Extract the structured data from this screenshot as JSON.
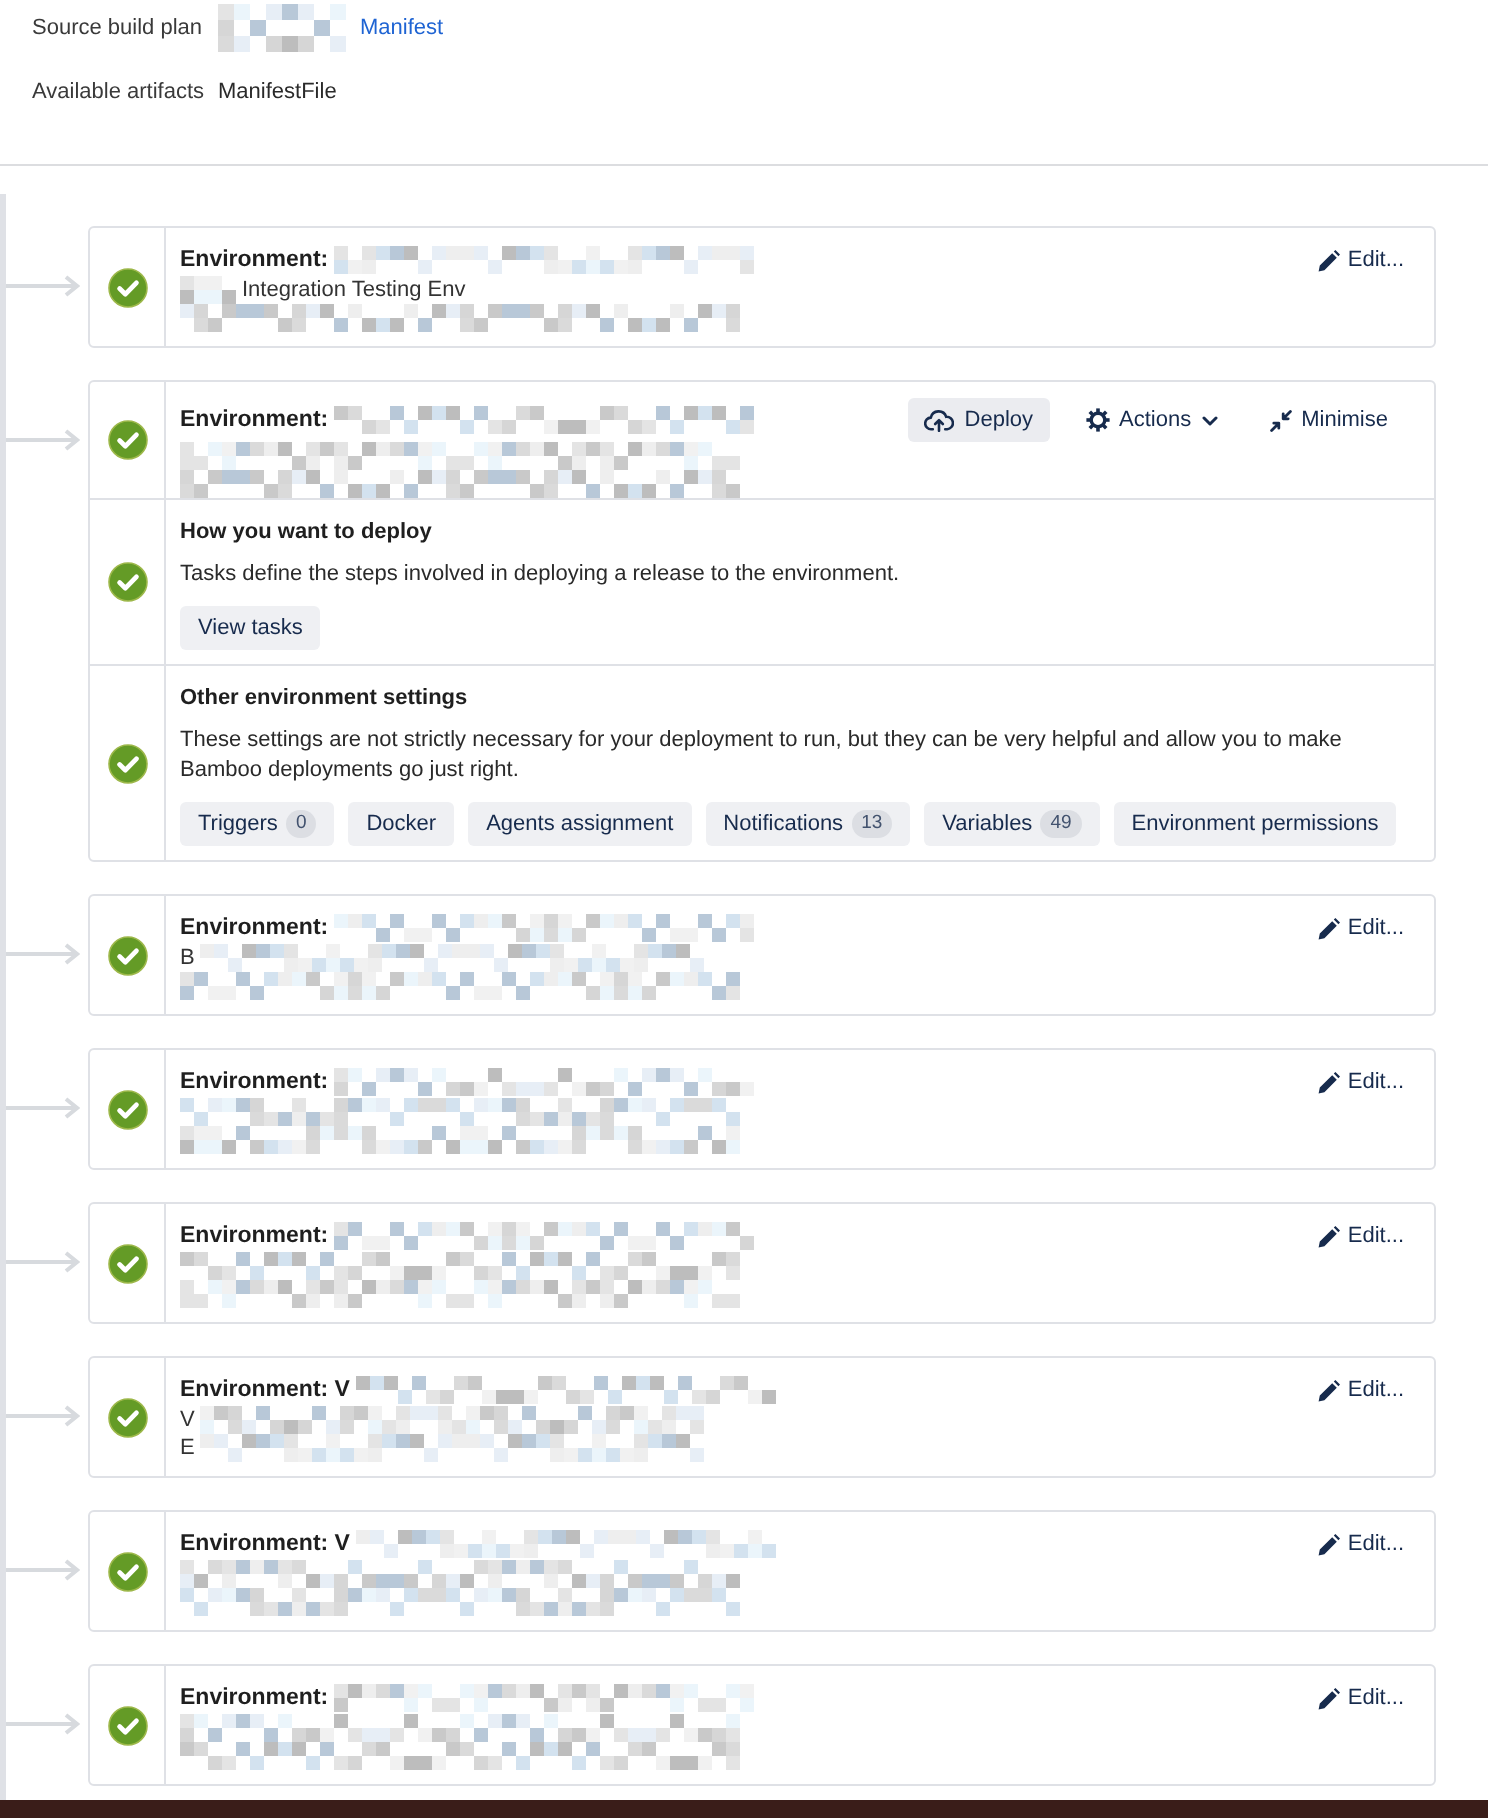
{
  "source": {
    "build_plan": {
      "label": "Source build plan",
      "link": "Manifest"
    },
    "artifacts": {
      "label": "Available artifacts",
      "value": "ManifestFile"
    }
  },
  "environments": [
    {
      "title": "Environment:",
      "passed": true,
      "lines": [
        {
          "kind": "suffix",
          "text": "Integration Testing Env"
        },
        {
          "kind": "masked"
        }
      ],
      "actions": [
        {
          "kind": "edit",
          "label": "Edit..."
        }
      ]
    },
    {
      "title": "Environment:",
      "passed": true,
      "lines": [
        {
          "kind": "masked"
        },
        {
          "kind": "masked"
        }
      ],
      "actions": [
        {
          "kind": "deploy",
          "label": "Deploy"
        },
        {
          "kind": "menu",
          "label": "Actions"
        },
        {
          "kind": "minimise",
          "label": "Minimise"
        }
      ],
      "sections": [
        {
          "heading": "How you want to deploy",
          "passed": true,
          "description": "Tasks define the steps involved in deploying a release to the environment.",
          "buttons": [
            {
              "label": "View tasks"
            }
          ]
        },
        {
          "heading": "Other environment settings",
          "passed": true,
          "description": "These settings are not strictly necessary for your deployment to run, but they can be very helpful and allow you to make Bamboo deployments go just right.",
          "buttons": [
            {
              "label": "Triggers",
              "count": "0"
            },
            {
              "label": "Docker"
            },
            {
              "label": "Agents assignment"
            },
            {
              "label": "Notifications",
              "count": "13"
            },
            {
              "label": "Variables",
              "count": "49"
            },
            {
              "label": "Environment permissions"
            }
          ]
        }
      ]
    },
    {
      "title": "Environment:",
      "passed": true,
      "lines": [
        {
          "kind": "prefix",
          "text": "B"
        },
        {
          "kind": "masked"
        }
      ],
      "actions": [
        {
          "kind": "edit",
          "label": "Edit..."
        }
      ]
    },
    {
      "title": "Environment:",
      "passed": true,
      "lines": [
        {
          "kind": "masked"
        },
        {
          "kind": "masked"
        }
      ],
      "actions": [
        {
          "kind": "edit",
          "label": "Edit..."
        }
      ]
    },
    {
      "title": "Environment:",
      "passed": true,
      "lines": [
        {
          "kind": "masked"
        },
        {
          "kind": "masked"
        }
      ],
      "actions": [
        {
          "kind": "edit",
          "label": "Edit..."
        }
      ]
    },
    {
      "title": "Environment: V",
      "passed": true,
      "lines": [
        {
          "kind": "prefix",
          "text": "V"
        },
        {
          "kind": "prefix",
          "text": "E"
        }
      ],
      "actions": [
        {
          "kind": "edit",
          "label": "Edit..."
        }
      ]
    },
    {
      "title": "Environment: V",
      "passed": true,
      "lines": [
        {
          "kind": "masked"
        },
        {
          "kind": "masked"
        }
      ],
      "actions": [
        {
          "kind": "edit",
          "label": "Edit..."
        }
      ]
    },
    {
      "title": "Environment:",
      "passed": true,
      "lines": [
        {
          "kind": "masked"
        },
        {
          "kind": "masked"
        }
      ],
      "actions": [
        {
          "kind": "edit",
          "label": "Edit..."
        }
      ]
    }
  ]
}
